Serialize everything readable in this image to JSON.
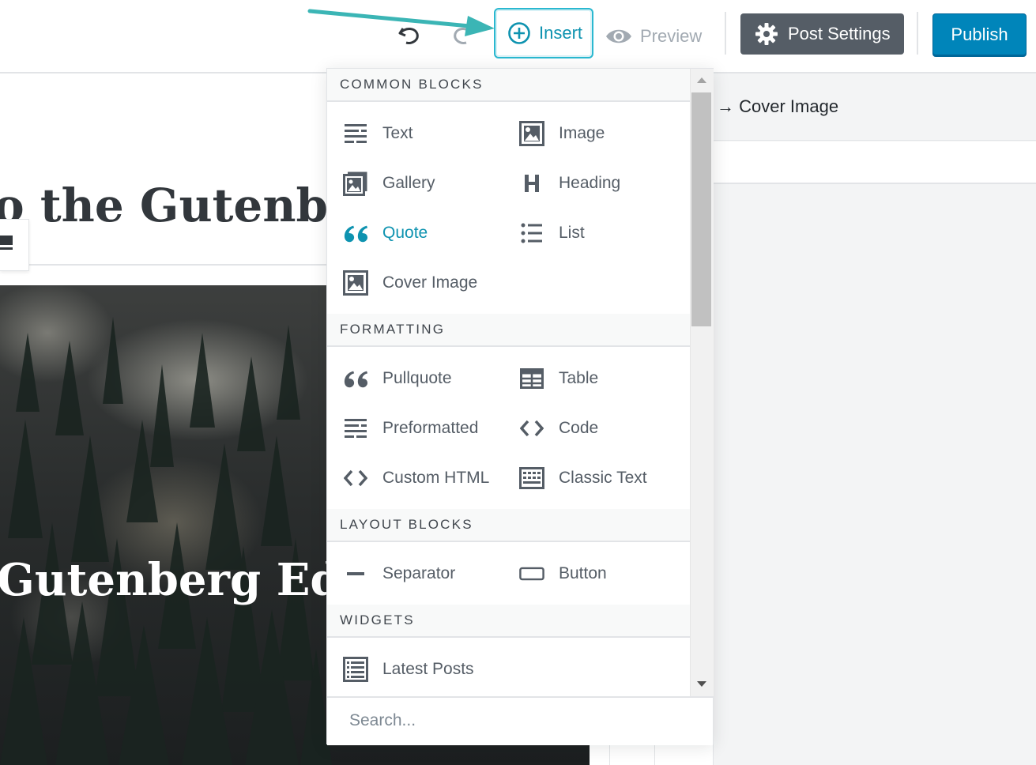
{
  "toolbar": {
    "insert_label": "Insert",
    "preview_label": "Preview",
    "post_settings_label": "Post Settings",
    "publish_label": "Publish"
  },
  "editor": {
    "post_title": "o the Gutenber",
    "cover_title": "Gutenberg Edit"
  },
  "sidebar": {
    "breadcrumb": "→ Cover Image"
  },
  "inserter": {
    "sections": [
      {
        "title": "COMMON BLOCKS",
        "items": [
          {
            "label": "Text",
            "icon": "text-icon"
          },
          {
            "label": "Image",
            "icon": "image-icon"
          },
          {
            "label": "Gallery",
            "icon": "gallery-icon"
          },
          {
            "label": "Heading",
            "icon": "heading-icon"
          },
          {
            "label": "Quote",
            "icon": "quote-icon"
          },
          {
            "label": "List",
            "icon": "list-icon"
          },
          {
            "label": "Cover Image",
            "icon": "cover-image-icon"
          }
        ]
      },
      {
        "title": "FORMATTING",
        "items": [
          {
            "label": "Pullquote",
            "icon": "pullquote-icon"
          },
          {
            "label": "Table",
            "icon": "table-icon"
          },
          {
            "label": "Preformatted",
            "icon": "preformatted-icon"
          },
          {
            "label": "Code",
            "icon": "code-icon"
          },
          {
            "label": "Custom HTML",
            "icon": "custom-html-icon"
          },
          {
            "label": "Classic Text",
            "icon": "classic-text-icon"
          }
        ]
      },
      {
        "title": "LAYOUT BLOCKS",
        "items": [
          {
            "label": "Separator",
            "icon": "separator-icon"
          },
          {
            "label": "Button",
            "icon": "button-icon"
          }
        ]
      },
      {
        "title": "WIDGETS",
        "items": [
          {
            "label": "Latest Posts",
            "icon": "latest-posts-icon"
          }
        ]
      }
    ],
    "search_placeholder": "Search...",
    "active_item": "Quote"
  },
  "colors": {
    "accent": "#0e93b0",
    "highlight_arrow": "#3bb5b5",
    "publish": "#0085ba",
    "post_settings": "#555d66"
  }
}
